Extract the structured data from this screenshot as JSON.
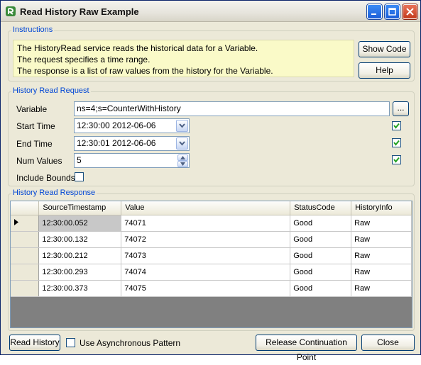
{
  "window": {
    "title": "Read History Raw Example"
  },
  "instructions": {
    "group_label": "Instructions",
    "lines": [
      "The HistoryRead service reads the historical data for a Variable.",
      "The request specifies a time range.",
      "The response is a list of raw values from the history for the Variable."
    ],
    "show_code_label": "Show Code",
    "help_label": "Help"
  },
  "request": {
    "group_label": "History Read Request",
    "variable_label": "Variable",
    "variable_value": "ns=4;s=CounterWithHistory",
    "browse_label": "...",
    "start_time_label": "Start Time",
    "start_time_value": "12:30:00 2012-06-06",
    "end_time_label": "End Time",
    "end_time_value": "12:30:01 2012-06-06",
    "num_values_label": "Num Values",
    "num_values_value": "5",
    "include_bounds_label": "Include Bounds",
    "start_time_enabled": true,
    "end_time_enabled": true,
    "num_values_enabled": true,
    "include_bounds_checked": false
  },
  "response": {
    "group_label": "History Read Response",
    "columns": [
      "",
      "SourceTimestamp",
      "Value",
      "StatusCode",
      "HistoryInfo"
    ],
    "rows": [
      {
        "timestamp": "12:30:00.052",
        "value": "74071",
        "status": "Good",
        "info": "Raw"
      },
      {
        "timestamp": "12:30:00.132",
        "value": "74072",
        "status": "Good",
        "info": "Raw"
      },
      {
        "timestamp": "12:30:00.212",
        "value": "74073",
        "status": "Good",
        "info": "Raw"
      },
      {
        "timestamp": "12:30:00.293",
        "value": "74074",
        "status": "Good",
        "info": "Raw"
      },
      {
        "timestamp": "12:30:00.373",
        "value": "74075",
        "status": "Good",
        "info": "Raw"
      }
    ]
  },
  "footer": {
    "read_history_label": "Read History",
    "async_label": "Use Asynchronous Pattern",
    "async_checked": false,
    "release_label": "Release Continuation Point",
    "close_label": "Close"
  },
  "colors": {
    "accent": "#0046d5",
    "instructions_bg": "#fafac8",
    "dialog_bg": "#ece9d8"
  }
}
